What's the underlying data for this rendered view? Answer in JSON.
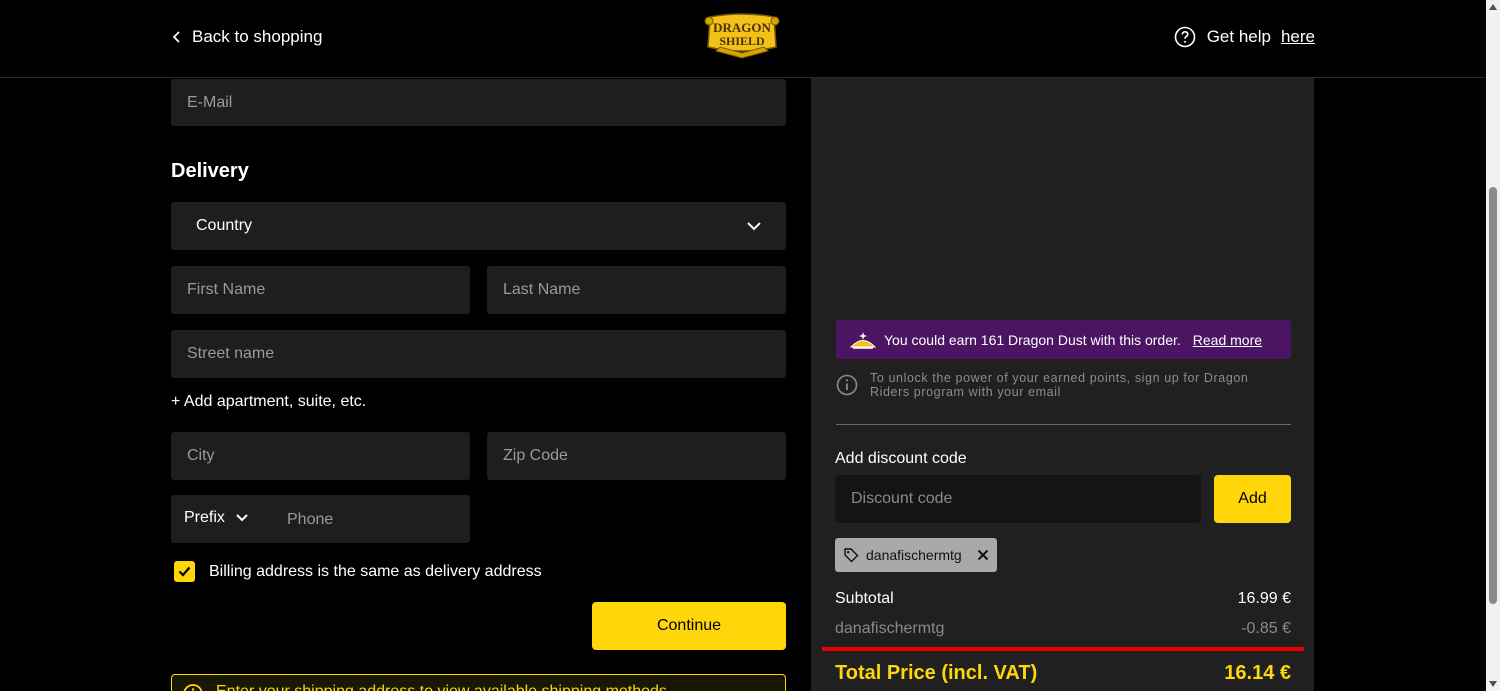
{
  "header": {
    "back_label": "Back to shopping",
    "logo_line1": "DRAGON",
    "logo_line2": "SHIELD",
    "help_prefix": "Get help",
    "help_link": "here"
  },
  "form": {
    "email_placeholder": "E-Mail",
    "delivery_title": "Delivery",
    "country_label": "Country",
    "first_name_placeholder": "First Name",
    "last_name_placeholder": "Last Name",
    "street_placeholder": "Street name",
    "add_apartment_label": "+ Add apartment, suite, etc.",
    "city_placeholder": "City",
    "zip_placeholder": "Zip Code",
    "prefix_label": "Prefix",
    "phone_placeholder": "Phone",
    "billing_same_label": "Billing address is the same as delivery address",
    "billing_same_checked": true,
    "continue_label": "Continue",
    "warning_text": "Enter your shipping address to view available shipping methods."
  },
  "summary": {
    "dust_text": "You could earn 161 Dragon Dust with this order.",
    "dust_link": "Read more",
    "info_text": "To unlock the power of your earned points, sign up for Dragon Riders program with your email",
    "discount_label": "Add discount code",
    "discount_placeholder": "Discount code",
    "add_label": "Add",
    "applied_code": "danafischermtg",
    "subtotal_label": "Subtotal",
    "subtotal_value": "16.99 €",
    "discount_row_label": "danafischermtg",
    "discount_row_value": "-0.85 €",
    "total_label": "Total Price (incl. VAT)",
    "total_value": "16.14 €"
  },
  "colors": {
    "accent_yellow": "#ffd60a",
    "dust_purple": "#4b1563",
    "highlight_red": "#ea0000",
    "input_bg": "#1e1e1e",
    "panel_bg": "#202020"
  }
}
